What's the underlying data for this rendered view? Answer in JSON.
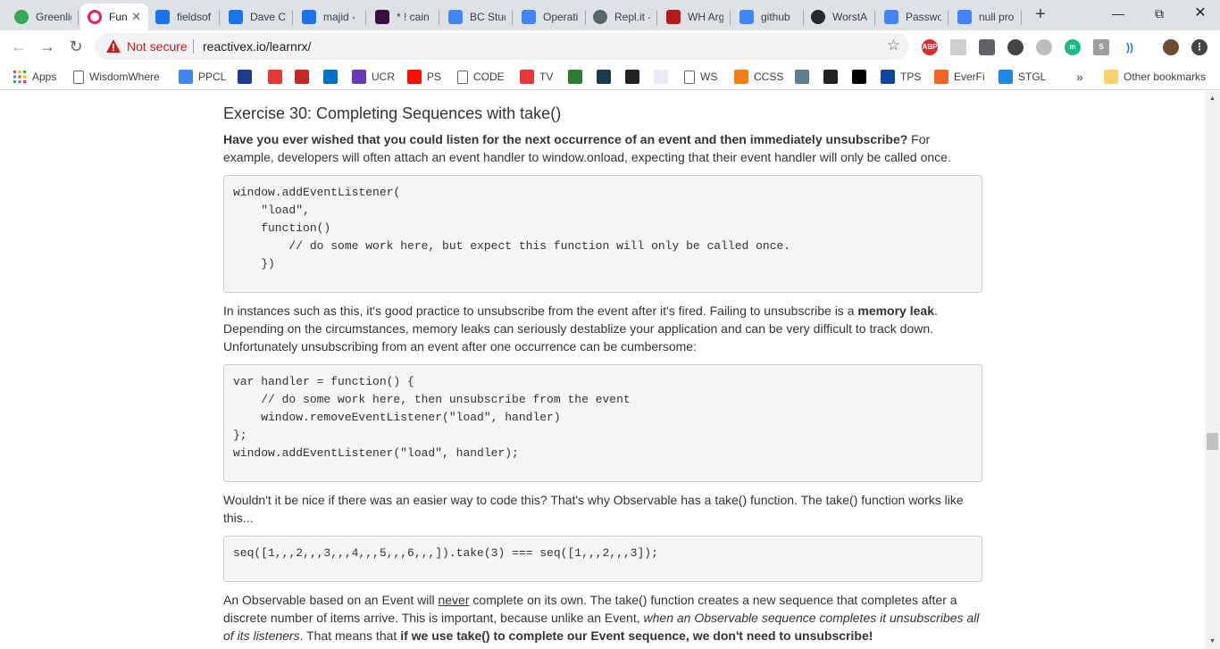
{
  "tabs": [
    {
      "title": "Greenlig",
      "favicon": "greenlight-icon",
      "color": "#34a853"
    },
    {
      "title": "Fun",
      "favicon": "codio-icon",
      "color": "#e91e63",
      "active": true
    },
    {
      "title": "fieldsof",
      "favicon": "classroom-icon",
      "color": "#1a73e8"
    },
    {
      "title": "Dave C",
      "favicon": "classroom-icon",
      "color": "#1a73e8"
    },
    {
      "title": "majid -",
      "favicon": "classroom-icon",
      "color": "#1a73e8"
    },
    {
      "title": "* ! cain",
      "favicon": "slack-icon",
      "color": "#3f0e40"
    },
    {
      "title": "BC Stud",
      "favicon": "docs-icon",
      "color": "#4285f4"
    },
    {
      "title": "Operati",
      "favicon": "docs-icon",
      "color": "#4285f4"
    },
    {
      "title": "Repl.it -",
      "favicon": "replit-icon",
      "color": "#56676e"
    },
    {
      "title": "WH Arg",
      "favicon": "tpm-icon",
      "color": "#b71c1c"
    },
    {
      "title": "github",
      "favicon": "google-icon",
      "color": "#4285f4"
    },
    {
      "title": "WorstA",
      "favicon": "github-icon",
      "color": "#24292e"
    },
    {
      "title": "Passwo",
      "favicon": "google-icon",
      "color": "#4285f4"
    },
    {
      "title": "null pro",
      "favicon": "google-icon",
      "color": "#4285f4"
    }
  ],
  "toolbar": {
    "not_secure": "Not secure",
    "url": "reactivex.io/learnrx/"
  },
  "bookmarks": [
    {
      "label": "Apps",
      "icon": "apps-grid-icon"
    },
    {
      "label": "WisdomWhere",
      "icon": "page-icon"
    },
    {
      "label": "PPCL",
      "icon": "docs-icon"
    },
    {
      "label": "",
      "icon": "shield-icon"
    },
    {
      "label": "",
      "icon": "lifebuoy-icon"
    },
    {
      "label": "",
      "icon": "red-logo-icon"
    },
    {
      "label": "",
      "icon": "outlook-icon"
    },
    {
      "label": "UCR",
      "icon": "forms-icon"
    },
    {
      "label": "PS",
      "icon": "adobe-icon"
    },
    {
      "label": "CODE",
      "icon": "page-icon"
    },
    {
      "label": "TV",
      "icon": "tv-logo-icon"
    },
    {
      "label": "",
      "icon": "plane-icon"
    },
    {
      "label": "",
      "icon": "p-logo-icon"
    },
    {
      "label": "",
      "icon": "bb-icon"
    },
    {
      "label": "",
      "icon": "drc-icon"
    },
    {
      "label": "WS",
      "icon": "page-icon"
    },
    {
      "label": "CCSS",
      "icon": "ccss-icon"
    },
    {
      "label": "",
      "icon": "grid-logo-icon"
    },
    {
      "label": "",
      "icon": "tv-icon"
    },
    {
      "label": "",
      "icon": "sac-icon"
    },
    {
      "label": "TPS",
      "icon": "tps-icon"
    },
    {
      "label": "EverFi",
      "icon": "everfi-icon"
    },
    {
      "label": "STGL",
      "icon": "stgl-icon"
    }
  ],
  "bookmarks_more": "»",
  "other_bookmarks": "Other bookmarks",
  "page": {
    "title": "Exercise 30: Completing Sequences with take()",
    "intro_bold": "Have you ever wished that you could listen for the next occurrence of an event and then immediately unsubscribe?",
    "intro_rest": " For example, developers will often attach an event handler to window.onload, expecting that their event handler will only be called once.",
    "code1": "window.addEventListener(\n    \"load\",\n    function()\n        // do some work here, but expect this function will only be called once.\n    })",
    "para2_a": "In instances such as this, it's good practice to unsubscribe from the event after it's fired. Failing to unsubscribe is a ",
    "para2_bold": "memory leak",
    "para2_b": ". Depending on the circumstances, memory leaks can seriously destablize your application and can be very difficult to track down. Unfortunately unsubscribing from an event after one occurrence can be cumbersome:",
    "code2": "var handler = function() {\n    // do some work here, then unsubscribe from the event\n    window.removeEventListener(\"load\", handler)\n};\nwindow.addEventListener(\"load\", handler);",
    "para3": "Wouldn't it be nice if there was an easier way to code this? That's why Observable has a take() function. The take() function works like this...",
    "code3": "seq([1,,,2,,,3,,,4,,,5,,,6,,,]).take(3) === seq([1,,,2,,,3]);",
    "para4_a": "An Observable based on an Event will ",
    "para4_u": "never",
    "para4_b": " complete on its own. The take() function creates a new sequence that completes after a discrete number of items arrive. This is important, because unlike an Event, ",
    "para4_i": "when an Observable sequence completes it unsubscribes all of its listeners",
    "para4_c": ". That means that ",
    "para4_bold": "if we use take() to complete our Event sequence, we don't need to unsubscribe!"
  }
}
